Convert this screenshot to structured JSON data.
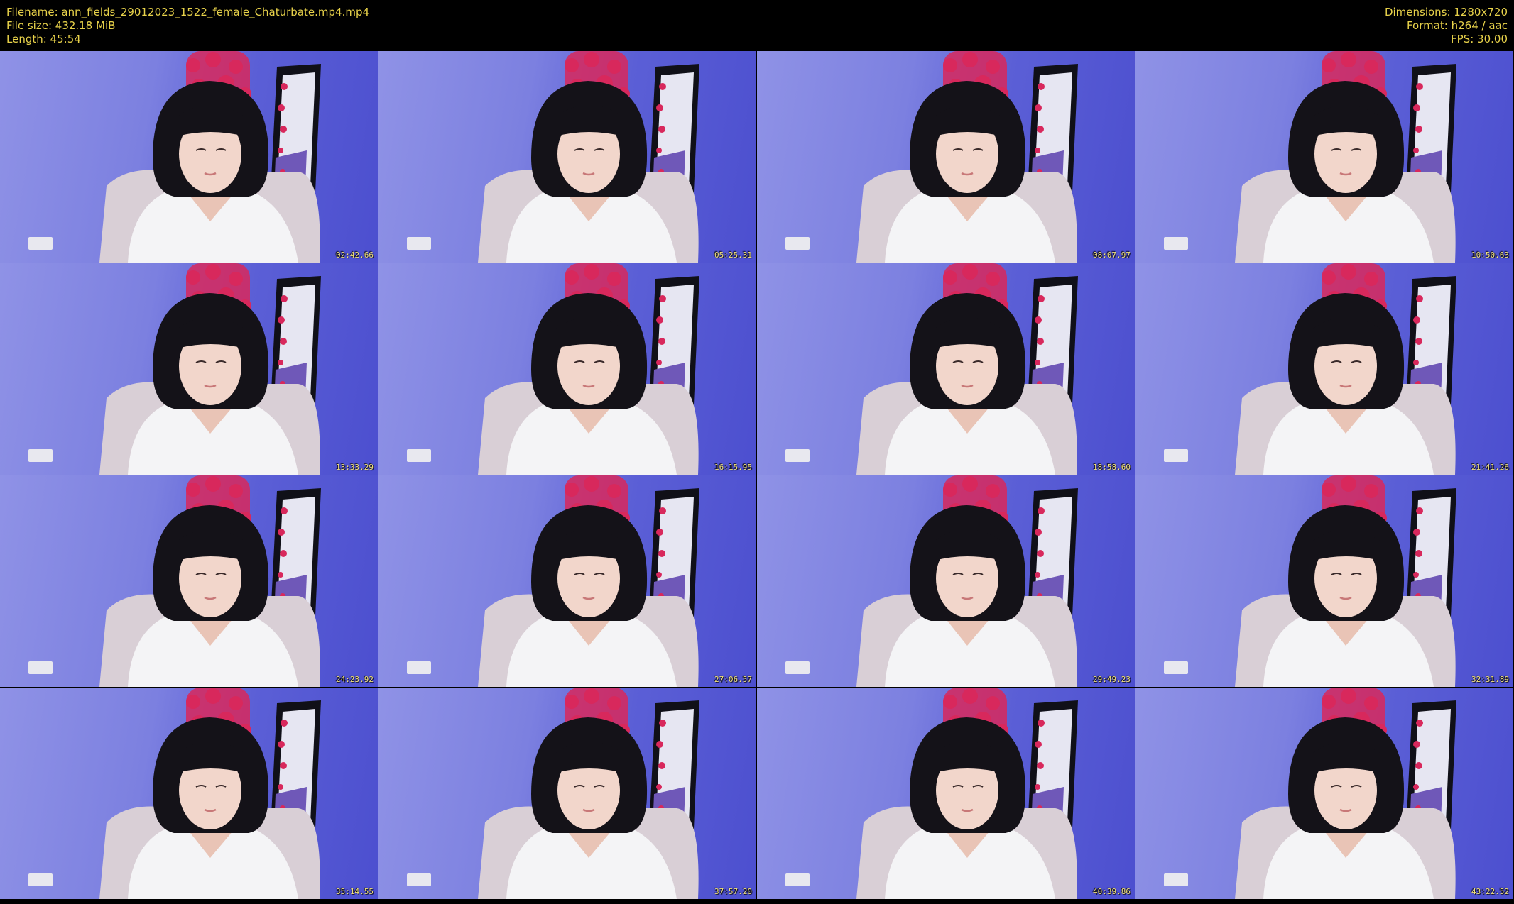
{
  "header": {
    "filename": "Filename: ann_fields_29012023_1522_female_Chaturbate.mp4.mp4",
    "filesize": "File size: 432.18 MiB",
    "length": "Length: 45:54",
    "dimensions": "Dimensions: 1280x720",
    "format": "Format: h264 / aac",
    "fps": "FPS: 30.00"
  },
  "thumbnails": [
    {
      "timestamp": "02:42.66"
    },
    {
      "timestamp": "05:25.31"
    },
    {
      "timestamp": "08:07.97"
    },
    {
      "timestamp": "10:50.63"
    },
    {
      "timestamp": "13:33.29"
    },
    {
      "timestamp": "16:15.95"
    },
    {
      "timestamp": "18:58.60"
    },
    {
      "timestamp": "21:41.26"
    },
    {
      "timestamp": "24:23.92"
    },
    {
      "timestamp": "27:06.57"
    },
    {
      "timestamp": "29:49.23"
    },
    {
      "timestamp": "32:31.89"
    },
    {
      "timestamp": "35:14.55"
    },
    {
      "timestamp": "37:57.20"
    },
    {
      "timestamp": "40:39.86"
    },
    {
      "timestamp": "43:22.52"
    }
  ],
  "colors": {
    "header_text": "#e8d24a",
    "timestamp_text": "#f0e07a",
    "wall_light": "#8f92e6",
    "wall_dark": "#4c4fcf",
    "flowers": "#d8285c",
    "hair": "#141218",
    "shirt": "#f4f4f6"
  }
}
